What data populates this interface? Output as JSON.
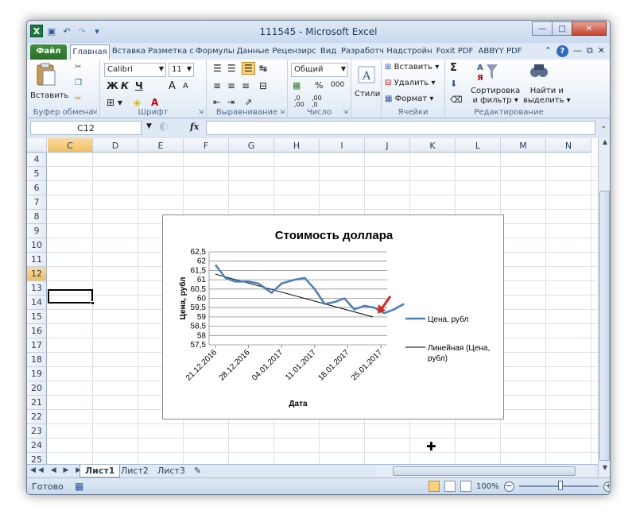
{
  "window": {
    "title": "111545 - Microsoft Excel"
  },
  "qat": {
    "undo_icon": "undo-icon",
    "redo_icon": "redo-icon",
    "save_icon": "save-icon"
  },
  "tabs": [
    {
      "label": "Файл"
    },
    {
      "label": "Главная"
    },
    {
      "label": "Вставка"
    },
    {
      "label": "Разметка с"
    },
    {
      "label": "Формулы"
    },
    {
      "label": "Данные"
    },
    {
      "label": "Рецензирс"
    },
    {
      "label": "Вид"
    },
    {
      "label": "Разработч"
    },
    {
      "label": "Надстройн"
    },
    {
      "label": "Foxit PDF"
    },
    {
      "label": "ABBYY PDF"
    }
  ],
  "ribbon": {
    "clipboard": {
      "paste": "Вставить",
      "label": "Буфер обмена"
    },
    "font": {
      "name": "Calibri",
      "size": "11",
      "label": "Шрифт",
      "bold": "Ж",
      "italic": "К",
      "underline": "Ч",
      "grow": "A",
      "shrink": "A"
    },
    "alignment": {
      "label": "Выравнивание"
    },
    "number": {
      "format": "Общий",
      "percent": "%",
      "thousands": "000",
      "inc": ",0\n,00",
      "label": "Число"
    },
    "styles": {
      "label": "Стили"
    },
    "cells": {
      "insert": "Вставить",
      "delete": "Удалить",
      "format": "Формат",
      "label": "Ячейки"
    },
    "editing": {
      "sum": "Σ",
      "sort": "Сортировка\nи фильтр",
      "sort_l1": "Сортировка",
      "sort_l2": "и фильтр",
      "find_l1": "Найти и",
      "find_l2": "выделить",
      "label": "Редактирование"
    }
  },
  "formula_bar": {
    "name_box": "C12",
    "fx": "fx",
    "value": ""
  },
  "columns": [
    "C",
    "D",
    "E",
    "F",
    "G",
    "H",
    "I",
    "J",
    "K",
    "L",
    "M",
    "N"
  ],
  "rows": [
    "4",
    "5",
    "6",
    "7",
    "8",
    "9",
    "10",
    "11",
    "12",
    "13",
    "14",
    "15",
    "16",
    "17",
    "18",
    "19",
    "20",
    "21",
    "22",
    "23",
    "24",
    "25"
  ],
  "selected": {
    "column": "C",
    "row": "12"
  },
  "chart_data": {
    "type": "line",
    "title": "Стоимость доллара",
    "xlabel": "Дата",
    "ylabel": "Цена, рубл",
    "ylim": [
      57.5,
      62.5
    ],
    "yticks": [
      "62,5",
      "62",
      "61,5",
      "61",
      "60,5",
      "60",
      "59,5",
      "59",
      "58,5",
      "58",
      "57,5"
    ],
    "xticks": [
      "21.12.2016",
      "28.12.2016",
      "04.01.2017",
      "11.01.2017",
      "18.01.2017",
      "25.01.2017"
    ],
    "series": [
      {
        "name": "Цена, рубл",
        "color": "#4a7ebb",
        "x_index": [
          0,
          0.3,
          0.6,
          1.0,
          1.3,
          1.7,
          2.0,
          2.4,
          2.7,
          3.0,
          3.3,
          3.6,
          3.9,
          4.2,
          4.5,
          4.8,
          5.1,
          5.4,
          5.7
        ],
        "values": [
          61.8,
          61.1,
          60.9,
          60.9,
          60.8,
          60.3,
          60.8,
          61.0,
          61.1,
          60.5,
          59.7,
          59.8,
          60.0,
          59.4,
          59.6,
          59.5,
          59.2,
          59.4,
          59.7
        ]
      }
    ],
    "trendline": {
      "name": "Линейная (Цена, рубл)",
      "start": 61.3,
      "end": 59.0,
      "color": "#000000"
    },
    "legend_position": "right",
    "annotation": "red-arrow"
  },
  "sheets": [
    "Лист1",
    "Лист2",
    "Лист3"
  ],
  "active_sheet": "Лист1",
  "status": {
    "text": "Готово",
    "zoom": "100%"
  }
}
